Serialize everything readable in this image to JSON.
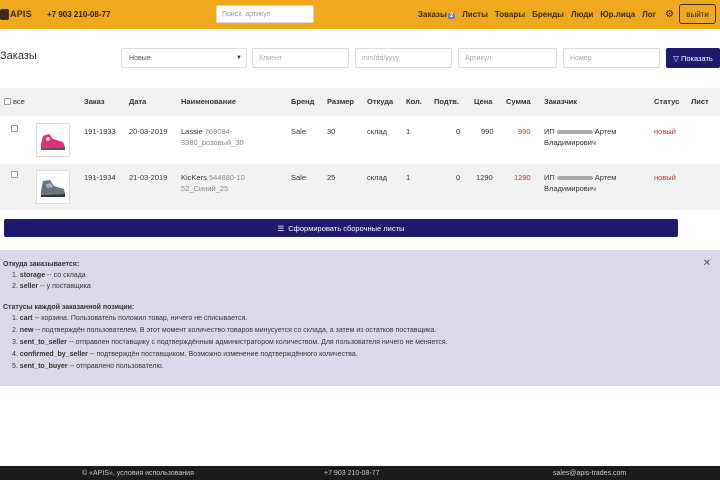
{
  "header": {
    "logo_text": "APIS",
    "phone": "+7 903 210-08-77",
    "search_placeholder": "Поиск, артикул",
    "nav": [
      {
        "label": "Заказы",
        "badge": "2"
      },
      {
        "label": "Листы"
      },
      {
        "label": "Товары"
      },
      {
        "label": "Бренды"
      },
      {
        "label": "Люди"
      },
      {
        "label": "Юр.лица"
      },
      {
        "label": "Лог"
      }
    ],
    "logout_label": "выйти",
    "accent_color": "#f0a81e"
  },
  "filters": {
    "page_title": "Заказы",
    "status_value": "Новые",
    "client_placeholder": "Клиент",
    "date_placeholder": "mm/dd/yyyy",
    "article_placeholder": "Артикул",
    "number_placeholder": "Номер",
    "show_label": "Показать"
  },
  "table": {
    "select_all_label": "все",
    "columns": [
      "Заказ",
      "Дата",
      "Наименование",
      "Бренд",
      "Размер",
      "Откуда",
      "Кол.",
      "Подтв.",
      "Цена",
      "Сумма",
      "Заказчик",
      "Статус",
      "Лист"
    ],
    "rows": [
      {
        "order": "191-1933",
        "date": "20-03-2019",
        "name": "Lassie",
        "code": "769094-",
        "code2": "3380_розовый_30",
        "brand": "Sale",
        "size": "30",
        "from": "склад",
        "qty": "1",
        "confirmed": "0",
        "price": "990",
        "sum": "990",
        "customer_prefix": "ИП",
        "customer_name": "Артем",
        "customer_patronymic": "Владимирович",
        "status": "новый"
      },
      {
        "order": "191-1934",
        "date": "21-03-2019",
        "name": "KicKers",
        "code": "544880-10",
        "code2": "52_Синий_25",
        "brand": "Sale",
        "size": "25",
        "from": "склад",
        "qty": "1",
        "confirmed": "0",
        "price": "1290",
        "sum": "1290",
        "customer_prefix": "ИП",
        "customer_name": "Артем",
        "customer_patronymic": "Владимирович",
        "status": "новый"
      }
    ]
  },
  "assemble_label": "Сформировать сборочные листы",
  "info": {
    "sources_title": "Откуда заказывается:",
    "sources": [
      {
        "num": "1.",
        "key": "storage",
        "text": "-- со склада"
      },
      {
        "num": "2.",
        "key": "seller",
        "text": "-- у поставщика"
      }
    ],
    "statuses_title": "Статусы каждой заказанной позиции:",
    "statuses": [
      {
        "num": "1.",
        "key": "cart",
        "text": "-- корзина. Пользователь положил товар, ничего не списывается."
      },
      {
        "num": "2.",
        "key": "new",
        "text": "-- подтверждён пользователем. В этот момент количество товаров минусуется со склада, а затем из остатков поставщика."
      },
      {
        "num": "3.",
        "key": "sent_to_seller",
        "text": "-- отправлен поставщику с подтверждённым администратором количеством. Для пользователя ничего не меняется."
      },
      {
        "num": "4.",
        "key": "confirmed_by_seller",
        "text": "-- подтверждён поставщиком. Возможно изменение подтверждённого количества."
      },
      {
        "num": "5.",
        "key": "sent_to_buyer",
        "text": "-- отправлено пользователю."
      }
    ],
    "panel_color": "#dcd8ec"
  },
  "footer": {
    "copyright": "© «APIS», условия использования",
    "phone": "+7 903 210-08-77",
    "email": "sales@apis-trades.com"
  }
}
